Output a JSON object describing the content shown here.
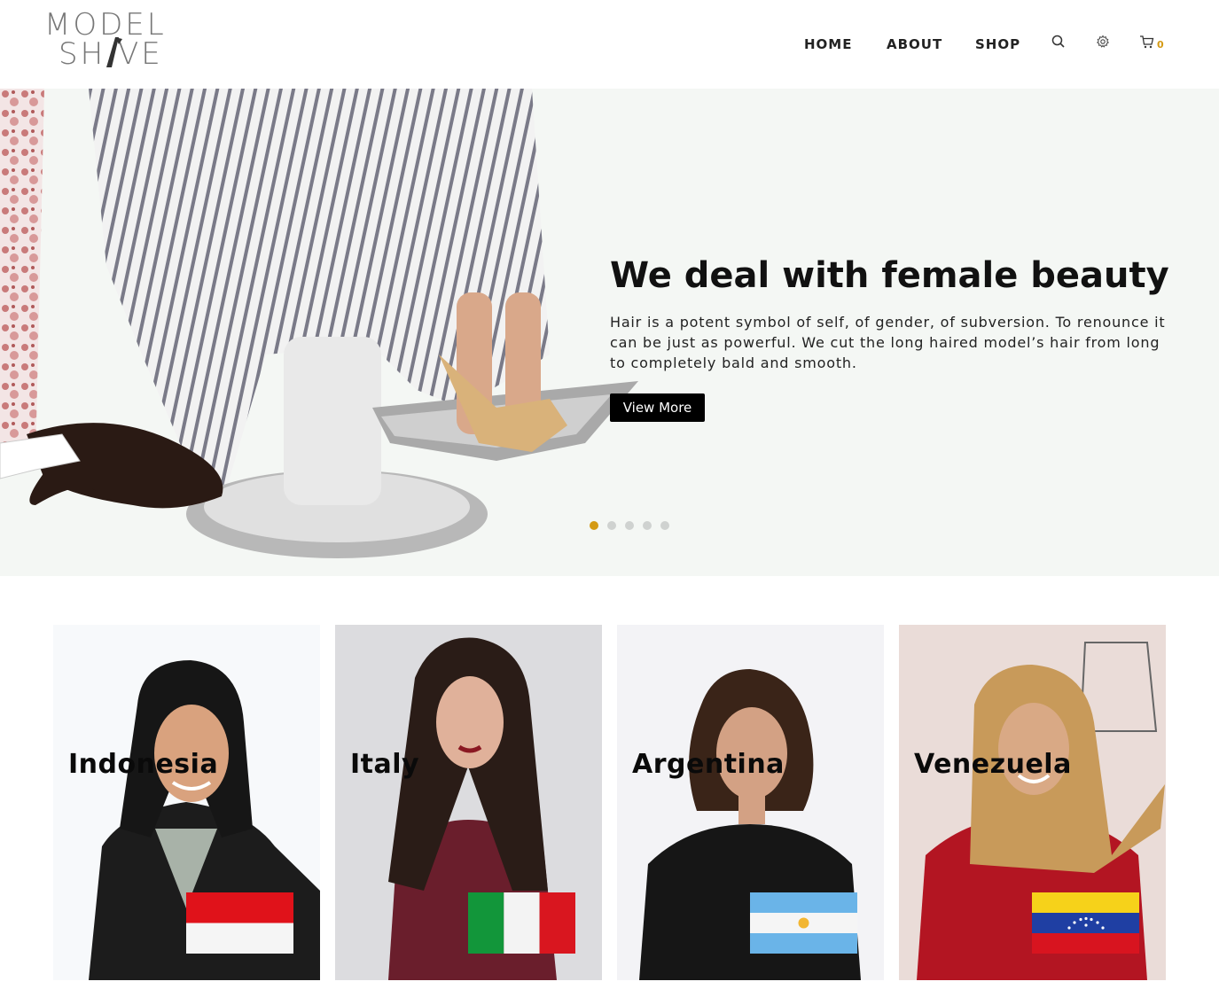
{
  "brand": {
    "logo_line1": "MODEL",
    "logo_line2": "SH  VE"
  },
  "nav": {
    "items": [
      {
        "label": "HOME"
      },
      {
        "label": "ABOUT"
      },
      {
        "label": "SHOP"
      }
    ],
    "icons": [
      "search-icon",
      "gear-icon",
      "cart-icon"
    ],
    "cart_count": "0"
  },
  "hero": {
    "title": "We deal with female beauty",
    "text": "Hair is a potent symbol of self, of gender, of subversion. To renounce it can be just as powerful. We cut the long haired model’s hair from long to completely bald and smooth.",
    "button_label": "View More",
    "slides_total": 5,
    "active_slide": 1
  },
  "cards": [
    {
      "label": "Indonesia",
      "flag": "indonesia-flag"
    },
    {
      "label": "Italy",
      "flag": "italy-flag"
    },
    {
      "label": "Argentina",
      "flag": "argentina-flag"
    },
    {
      "label": "Venezuela",
      "flag": "venezuela-flag"
    }
  ],
  "colors": {
    "accent": "#d49a14",
    "hero_bg": "#f4f7f4",
    "button_bg": "#000000",
    "text": "#111111"
  }
}
